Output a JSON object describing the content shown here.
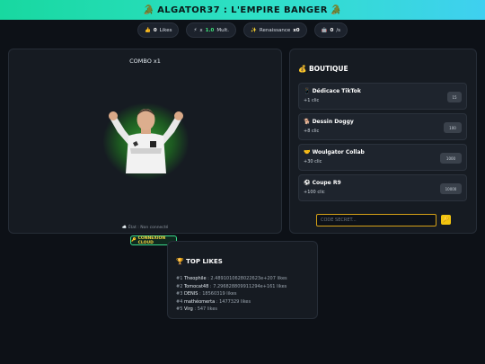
{
  "header": {
    "title": "ALGATOR37 : L'EMPIRE BANGER",
    "icon_left": "crocodile-icon",
    "icon_right": "crocodile-icon",
    "colors": {
      "gradient_start": "#18d8a0",
      "gradient_end": "#3fd0f0"
    }
  },
  "stats": [
    {
      "icon": "thumbs-up-icon",
      "value": "0",
      "label": "Likes"
    },
    {
      "icon": "lightning-icon",
      "prefix": "x",
      "value": "1.0",
      "label": "Mult."
    },
    {
      "icon": "sparkles-icon",
      "label": "Renaissance",
      "value": "x0"
    },
    {
      "icon": "robot-icon",
      "value": "0",
      "suffix": "/s"
    }
  ],
  "game": {
    "combo": "COMBO x1",
    "state": "État : Non connecté",
    "connect_label": "CONNEXION CLOUD",
    "colors": {
      "glow": "#50ff3c",
      "connect_border": "#39d98a",
      "connect_text": "#f5d742"
    }
  },
  "shop": {
    "title": "BOUTIQUE",
    "items": [
      {
        "icon": "phone-icon",
        "name": "Dédicace TikTok",
        "gain": "+1 clic",
        "price": "15"
      },
      {
        "icon": "dog-icon",
        "name": "Dessin Doggy",
        "gain": "+8 clic",
        "price": "100"
      },
      {
        "icon": "handshake-icon",
        "name": "Woulgator Collab",
        "gain": "+30 clic",
        "price": "1000"
      },
      {
        "icon": "soccer-icon",
        "name": "Coupe R9",
        "gain": "+100 clic",
        "price": "10000"
      }
    ],
    "code_placeholder": "CODE SECRET...",
    "code_button": "🔑"
  },
  "leaderboard": {
    "title": "TOP LIKES",
    "rows": [
      {
        "rank": "#1",
        "name": "Theophile",
        "likes": "2.4891010628022623e+207 likes"
      },
      {
        "rank": "#2",
        "name": "Tomocat48",
        "likes": "7.296828809911294e+161 likes"
      },
      {
        "rank": "#3",
        "name": "DENIS",
        "likes": "18560319 likes"
      },
      {
        "rank": "#4",
        "name": "mathéomerta",
        "likes": "1477329 likes"
      },
      {
        "rank": "#5",
        "name": "Virg",
        "likes": "547 likes"
      }
    ]
  }
}
